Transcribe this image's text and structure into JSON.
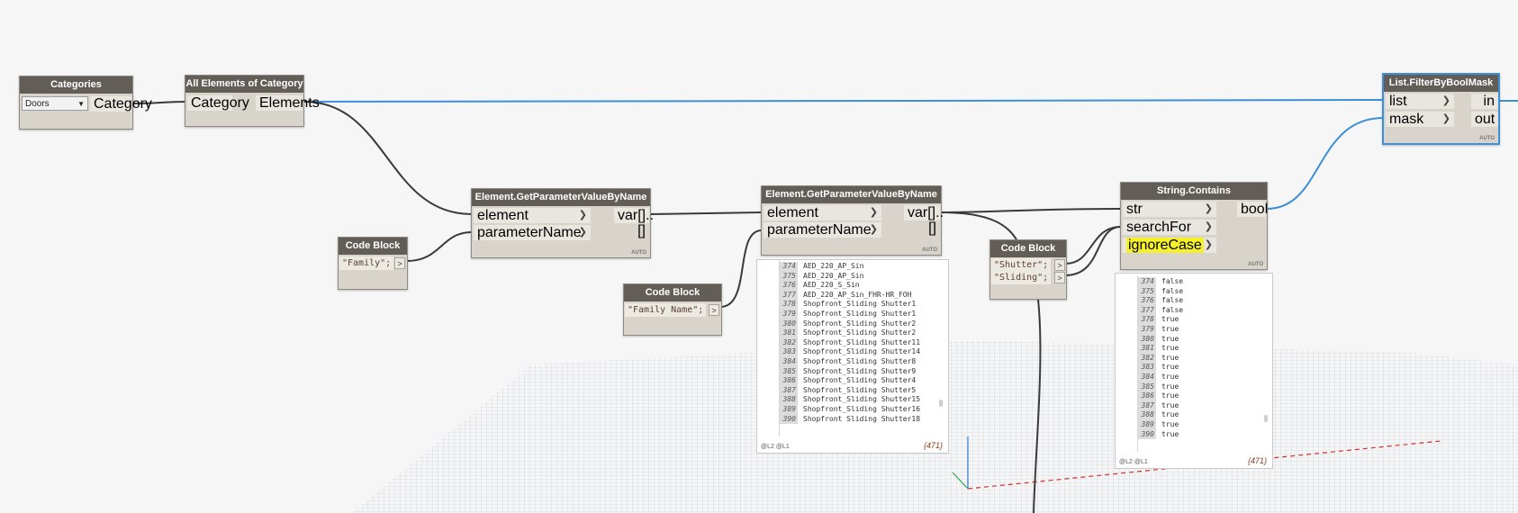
{
  "colors": {
    "accent_blue": "#3d8fd6",
    "wire_dark": "#3a3a3a",
    "node_header": "#625d56",
    "node_body": "#d8d4cc",
    "highlight_yellow": "#f5f02a",
    "count_color": "#8a3a1a"
  },
  "nodes": {
    "categories": {
      "title": "Categories",
      "dropdown_value": "Doors",
      "output": "Category"
    },
    "all_elements": {
      "title": "All Elements of Category",
      "input": "Category",
      "output": "Elements"
    },
    "get_param_1": {
      "title": "Element.GetParameterValueByName",
      "inputs": [
        "element",
        "parameterName"
      ],
      "output": "var[]..[]",
      "auto": "AUTO"
    },
    "code_block_family": {
      "title": "Code Block",
      "code": "\"Family\";",
      "out": ">"
    },
    "get_param_2": {
      "title": "Element.GetParameterValueByName",
      "inputs": [
        "element",
        "parameterName"
      ],
      "output": "var[]..[]",
      "auto": "AUTO"
    },
    "code_block_family_name": {
      "title": "Code Block",
      "code": "\"Family Name\";",
      "out": ">"
    },
    "code_block_search": {
      "title": "Code Block",
      "lines": [
        "\"Shutter\";",
        "\"Sliding\";"
      ],
      "out": ">"
    },
    "string_contains": {
      "title": "String.Contains",
      "inputs": [
        "str",
        "searchFor",
        "ignoreCase"
      ],
      "output": "bool",
      "auto": "AUTO"
    },
    "filter_by_bool_mask": {
      "title": "List.FilterByBoolMask",
      "inputs": [
        "list",
        "mask"
      ],
      "outputs": [
        "in",
        "out"
      ],
      "auto": "AUTO"
    }
  },
  "watch_names": {
    "rows": [
      {
        "idx": "374",
        "value": "AED_220_AP_Sin"
      },
      {
        "idx": "375",
        "value": "AED_220_AP_Sin"
      },
      {
        "idx": "376",
        "value": "AED_220_S_Sin"
      },
      {
        "idx": "377",
        "value": "AED_220_AP_Sin_FHR-HR_FOH"
      },
      {
        "idx": "378",
        "value": "Shopfront_Sliding Shutter1"
      },
      {
        "idx": "379",
        "value": "Shopfront_Sliding Shutter1"
      },
      {
        "idx": "380",
        "value": "Shopfront_Sliding Shutter2"
      },
      {
        "idx": "381",
        "value": "Shopfront_Sliding Shutter2"
      },
      {
        "idx": "382",
        "value": "Shopfront_Sliding Shutter11"
      },
      {
        "idx": "383",
        "value": "Shopfront_Sliding Shutter14"
      },
      {
        "idx": "384",
        "value": "Shopfront_Sliding Shutter8"
      },
      {
        "idx": "385",
        "value": "Shopfront_Sliding Shutter9"
      },
      {
        "idx": "386",
        "value": "Shopfront_Sliding Shutter4"
      },
      {
        "idx": "387",
        "value": "Shopfront_Sliding Shutter5"
      },
      {
        "idx": "388",
        "value": "Shopfront_Sliding Shutter15"
      },
      {
        "idx": "389",
        "value": "Shopfront_Sliding Shutter16"
      },
      {
        "idx": "390",
        "value": "Shopfront Sliding Shutter18"
      }
    ],
    "levels": "@L2 @L1",
    "count": "{471}"
  },
  "watch_bools": {
    "rows": [
      {
        "idx": "374",
        "value": "false"
      },
      {
        "idx": "375",
        "value": "false"
      },
      {
        "idx": "376",
        "value": "false"
      },
      {
        "idx": "377",
        "value": "false"
      },
      {
        "idx": "378",
        "value": "true"
      },
      {
        "idx": "379",
        "value": "true"
      },
      {
        "idx": "380",
        "value": "true"
      },
      {
        "idx": "381",
        "value": "true"
      },
      {
        "idx": "382",
        "value": "true"
      },
      {
        "idx": "383",
        "value": "true"
      },
      {
        "idx": "384",
        "value": "true"
      },
      {
        "idx": "385",
        "value": "true"
      },
      {
        "idx": "386",
        "value": "true"
      },
      {
        "idx": "387",
        "value": "true"
      },
      {
        "idx": "388",
        "value": "true"
      },
      {
        "idx": "389",
        "value": "true"
      },
      {
        "idx": "390",
        "value": "true"
      }
    ],
    "levels": "@L2 @L1",
    "count": "{471}"
  }
}
